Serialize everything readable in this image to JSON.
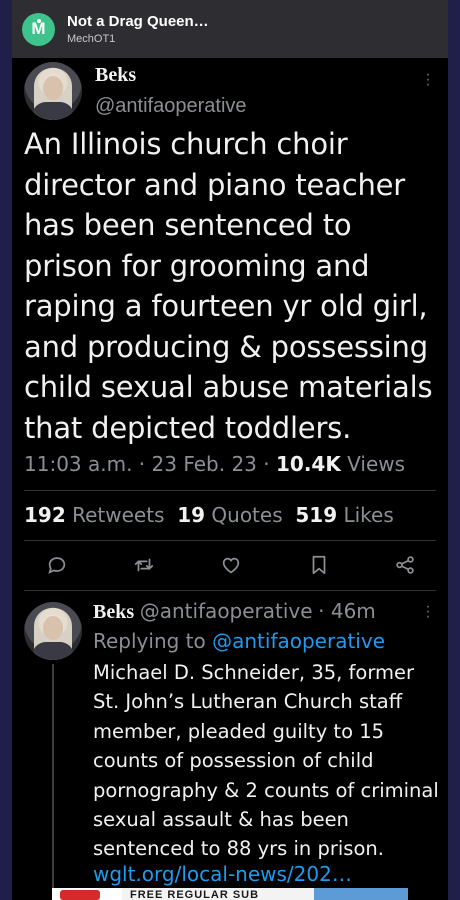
{
  "app_header": {
    "title": "Not a Drag Queen…",
    "subtitle": "MechOT1",
    "avatar_letter": "M",
    "avatar_color": "#3ec38d"
  },
  "tweet": {
    "author_name": "Beks",
    "author_handle": "@antifaoperative",
    "text": "An Illinois church choir director and piano teacher has been sentenced to prison for grooming and raping a fourteen yr old girl, and producing & possessing child sexual abuse materials that depicted toddlers.",
    "timestamp": "11:03 a.m. · 23 Feb. 23 · ",
    "views_count": "10.4K",
    "views_label": " Views",
    "retweets_count": "192",
    "retweets_label": "Retweets",
    "quotes_count": "19",
    "quotes_label": "Quotes",
    "likes_count": "519",
    "likes_label": "Likes",
    "actions": [
      "reply-icon",
      "retweet-icon",
      "like-icon",
      "bookmark-icon",
      "share-icon"
    ]
  },
  "reply": {
    "author_name": "Beks",
    "author_handle": "@antifaoperative",
    "time": "· 46m",
    "replying_to_label": "Replying to ",
    "replying_to_handle": "@antifaoperative",
    "text": "Michael D. Schneider, 35, former St. John’s Lutheran Church staff member, pleaded guilty to 15 counts of possession of child pornography & 2 counts of criminal sexual assault & has been sentenced to 88 yrs in prison.",
    "link": "wglt.org/local-news/202…"
  },
  "ad_banner": {
    "text": "FREE REGULAR SUB"
  },
  "colors": {
    "background": "#000000",
    "accent_link": "#1d9bf0",
    "muted_text": "#8b8f94"
  }
}
